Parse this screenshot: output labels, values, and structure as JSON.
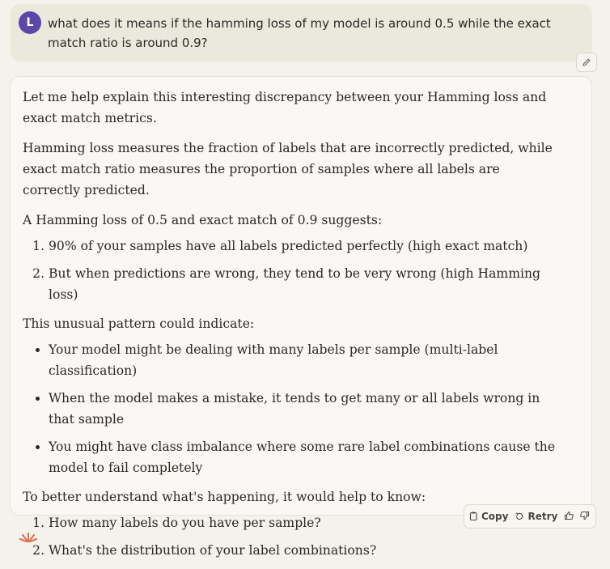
{
  "user": {
    "initial": "L",
    "message": "what does it means if the hamming loss of my model is around 0.5 while the exact match ratio is around 0.9?"
  },
  "assistant": {
    "intro": "Let me help explain this interesting discrepancy between your Hamming loss and exact match metrics.",
    "definition": "Hamming loss measures the fraction of labels that are incorrectly predicted, while exact match ratio measures the proportion of samples where all labels are correctly predicted.",
    "suggests_heading": "A Hamming loss of 0.5 and exact match of 0.9 suggests:",
    "suggests_items": [
      "90% of your samples have all labels predicted perfectly (high exact match)",
      "But when predictions are wrong, they tend to be very wrong (high Hamming loss)"
    ],
    "indicate_heading": "This unusual pattern could indicate:",
    "indicate_items": [
      "Your model might be dealing with many labels per sample (multi-label classification)",
      "When the model makes a mistake, it tends to get many or all labels wrong in that sample",
      "You might have class imbalance where some rare label combinations cause the model to fail completely"
    ],
    "know_heading": "To better understand what's happening, it would help to know:",
    "know_items": [
      "How many labels do you have per sample?",
      "What's the distribution of your label combinations?"
    ]
  },
  "actions": {
    "copy_label": "Copy",
    "retry_label": "Retry"
  },
  "colors": {
    "avatar": "#5a48a8",
    "logo": "#d97757",
    "user_bubble": "#ebe8dc"
  },
  "icons": [
    "pencil-icon",
    "copy-icon",
    "retry-icon",
    "thumbs-up-icon",
    "thumbs-down-icon",
    "claude-logo-icon"
  ]
}
